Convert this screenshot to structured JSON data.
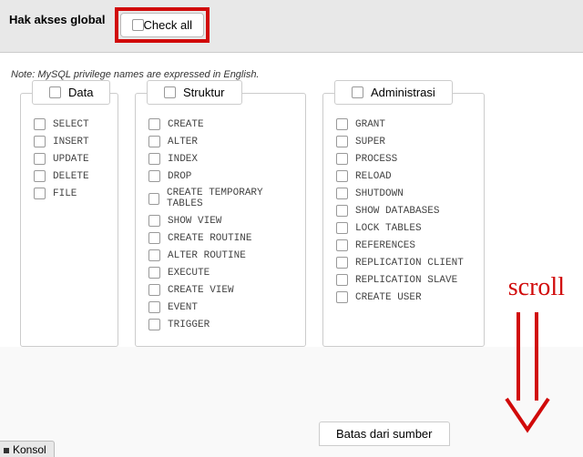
{
  "header": {
    "global_label": "Hak akses global",
    "check_all_label": "Check all"
  },
  "note": "Note: MySQL privilege names are expressed in English.",
  "groups": {
    "data": {
      "legend": "Data",
      "items": [
        "SELECT",
        "INSERT",
        "UPDATE",
        "DELETE",
        "FILE"
      ]
    },
    "struktur": {
      "legend": "Struktur",
      "items": [
        "CREATE",
        "ALTER",
        "INDEX",
        "DROP",
        "CREATE TEMPORARY TABLES",
        "SHOW VIEW",
        "CREATE ROUTINE",
        "ALTER ROUTINE",
        "EXECUTE",
        "CREATE VIEW",
        "EVENT",
        "TRIGGER"
      ]
    },
    "admin": {
      "legend": "Administrasi",
      "items": [
        "GRANT",
        "SUPER",
        "PROCESS",
        "RELOAD",
        "SHUTDOWN",
        "SHOW DATABASES",
        "LOCK TABLES",
        "REFERENCES",
        "REPLICATION CLIENT",
        "REPLICATION SLAVE",
        "CREATE USER"
      ]
    }
  },
  "limits_legend": "Batas dari sumber",
  "console_label": "Konsol",
  "annotation": {
    "scroll": "scroll"
  }
}
